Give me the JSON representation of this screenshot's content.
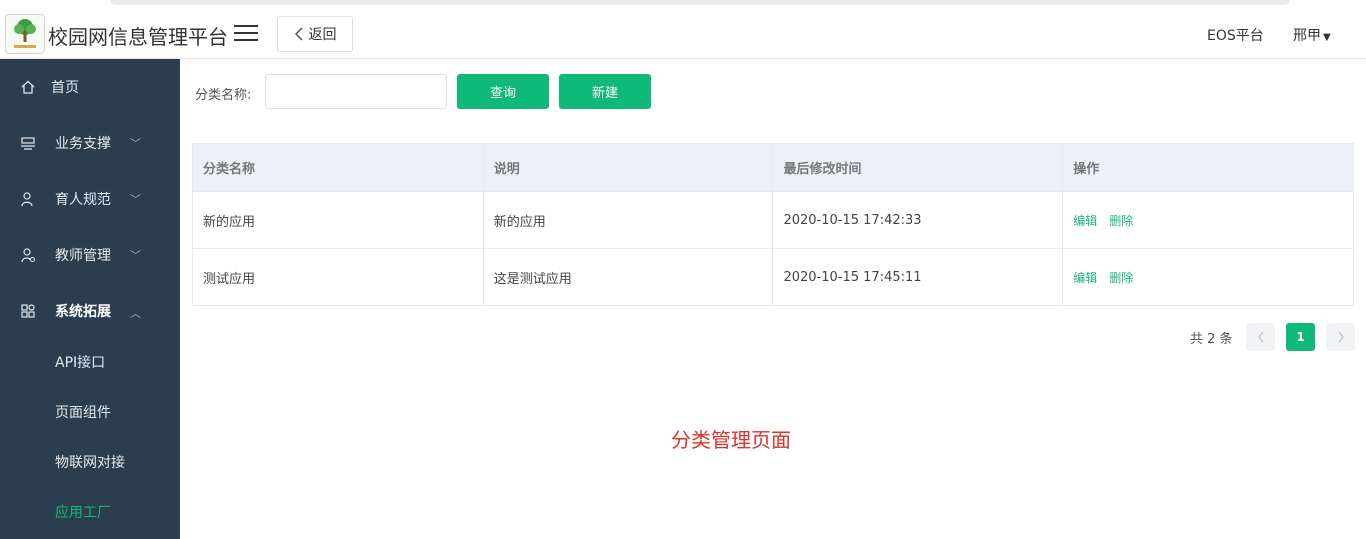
{
  "header": {
    "app_title": "校园网信息管理平台",
    "back_label": "返回",
    "eos_label": "EOS平台",
    "user_name": "邢甲"
  },
  "sidebar": {
    "items": [
      {
        "label": "首页",
        "icon": "home-icon"
      },
      {
        "label": "业务支撑",
        "icon": "business-icon",
        "expandable": true
      },
      {
        "label": "育人规范",
        "icon": "person-rules-icon",
        "expandable": true
      },
      {
        "label": "教师管理",
        "icon": "teacher-icon",
        "expandable": true
      },
      {
        "label": "系统拓展",
        "icon": "grid-extend-icon",
        "expandable": true,
        "expanded": true
      }
    ],
    "sub_items": [
      {
        "label": "API接口"
      },
      {
        "label": "页面组件"
      },
      {
        "label": "物联网对接"
      },
      {
        "label": "应用工厂",
        "active": true
      }
    ],
    "active_color": "#15b877"
  },
  "filter": {
    "label": "分类名称:",
    "input_value": "",
    "query_label": "查询",
    "create_label": "新建"
  },
  "table": {
    "headers": [
      "分类名称",
      "说明",
      "最后修改时间",
      "操作"
    ],
    "rows": [
      {
        "name": "新的应用",
        "desc": "新的应用",
        "time": "2020-10-15 17:42:33",
        "edit": "编辑",
        "delete": "删除"
      },
      {
        "name": "测试应用",
        "desc": "这是测试应用",
        "time": "2020-10-15 17:45:11",
        "edit": "编辑",
        "delete": "删除"
      }
    ]
  },
  "pagination": {
    "total_text": "共 2 条",
    "current_page": "1"
  },
  "caption": "分类管理页面",
  "colors": {
    "sidebar_bg": "#2b3e50",
    "accent": "#0fb977",
    "caption": "#e0312a"
  }
}
